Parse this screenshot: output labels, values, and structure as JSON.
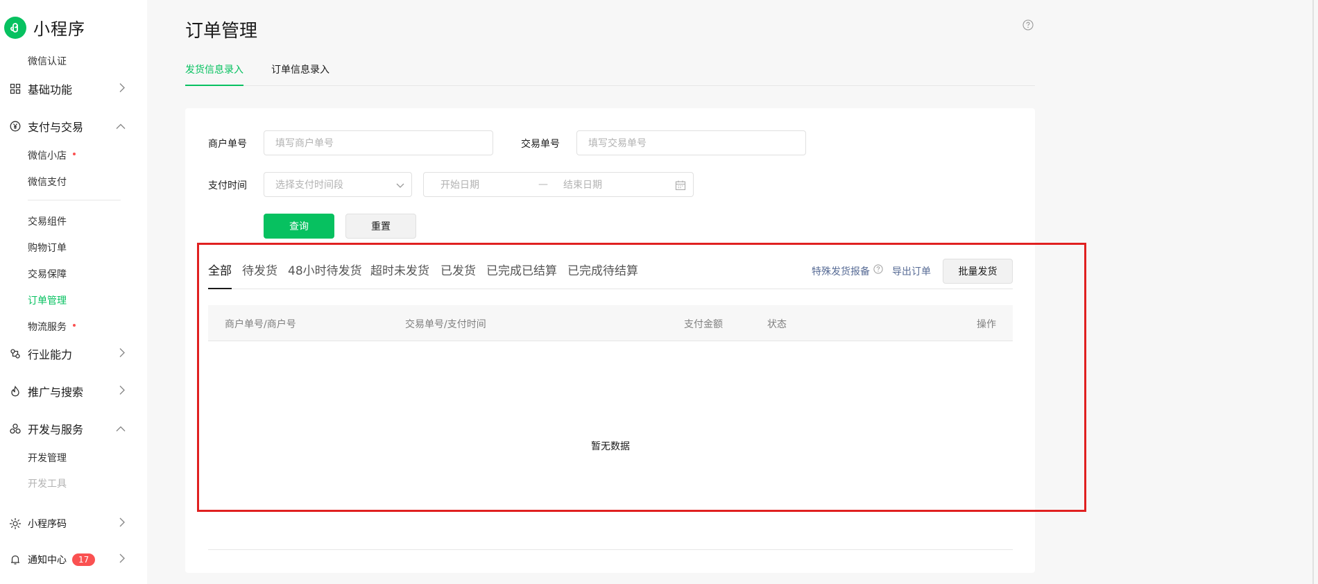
{
  "app": {
    "name": "小程序"
  },
  "sidebar": {
    "wechat_verify": "微信认证",
    "basic": "基础功能",
    "payment": "支付与交易",
    "payment_items": [
      "微信小店",
      "微信支付",
      "交易组件",
      "购物订单",
      "交易保障",
      "订单管理",
      "物流服务"
    ],
    "industry": "行业能力",
    "promotion": "推广与搜索",
    "dev": "开发与服务",
    "dev_items": [
      "开发管理",
      "开发工具"
    ],
    "miniprogram_code": "小程序码",
    "notifications": "通知中心",
    "notifications_count": "17"
  },
  "page": {
    "title": "订单管理",
    "tabs": [
      "发货信息录入",
      "订单信息录入"
    ]
  },
  "filters": {
    "merchant_no_label": "商户单号",
    "merchant_no_placeholder": "填写商户单号",
    "transaction_no_label": "交易单号",
    "transaction_no_placeholder": "填写交易单号",
    "pay_time_label": "支付时间",
    "pay_time_placeholder": "选择支付时间段",
    "start_date": "开始日期",
    "date_separator": "—",
    "end_date": "结束日期",
    "query": "查询",
    "reset": "重置"
  },
  "status_tabs": [
    "全部",
    "待发货",
    "48小时待发货",
    "超时未发货",
    "已发货",
    "已完成已结算",
    "已完成待结算"
  ],
  "actions": {
    "special_report": "特殊发货报备",
    "export": "导出订单",
    "batch_ship": "批量发货"
  },
  "table": {
    "columns": [
      "商户单号/商户号",
      "交易单号/支付时间",
      "支付金额",
      "状态",
      "操作"
    ],
    "empty": "暂无数据"
  },
  "colors": {
    "accent": "#07c160",
    "link": "#576b95",
    "badge": "#fa5151",
    "highlight": "#e02020"
  }
}
